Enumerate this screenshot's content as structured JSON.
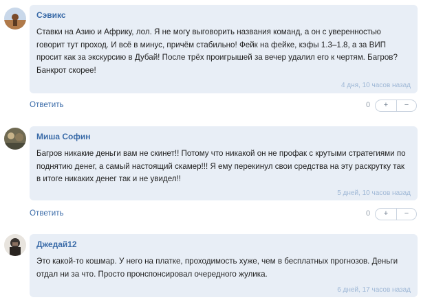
{
  "comments": [
    {
      "author": "Сэвикс",
      "text_lines": [
        "Ставки на Азию и Африку, лол. Я не могу выговорить названия команд, а он с уверенностью",
        "говорит тут проход. И всё в минус, причём стабильно! Фейк на фейке, кэфы 1.3–1.8, а за ВИП",
        "просит как за экскурсию в Дубай! После трёх проигрышей за вечер удалил его к чертям. Багров?",
        "Банкрот скорее!"
      ],
      "time": "4 дня, 10 часов назад",
      "reply_label": "Ответить",
      "score": "0",
      "plus": "+",
      "minus": "−"
    },
    {
      "author": "Миша Софин",
      "text_lines": [
        "Багров никакие деньги вам не скинет!! Потому что никакой он не профак с крутыми стратегиями по",
        "поднятию денег, а самый настоящий скамер!!! Я ему перекинул свои средства на эту раскрутку так",
        "в итоге никаких денег так и не увидел!!"
      ],
      "time": "5 дней, 10 часов назад",
      "reply_label": "Ответить",
      "score": "0",
      "plus": "+",
      "minus": "−"
    },
    {
      "author": "Джедай12",
      "text_lines": [
        "Это какой-то кошмар. У него на платке, проходимость хуже, чем в бесплатных прогнозов. Деньги",
        "отдал ни за что. Просто пронспонсировал очередного жулика."
      ],
      "time": "6 дней, 17 часов назад",
      "reply_label": "",
      "score": "",
      "plus": "",
      "minus": ""
    }
  ]
}
